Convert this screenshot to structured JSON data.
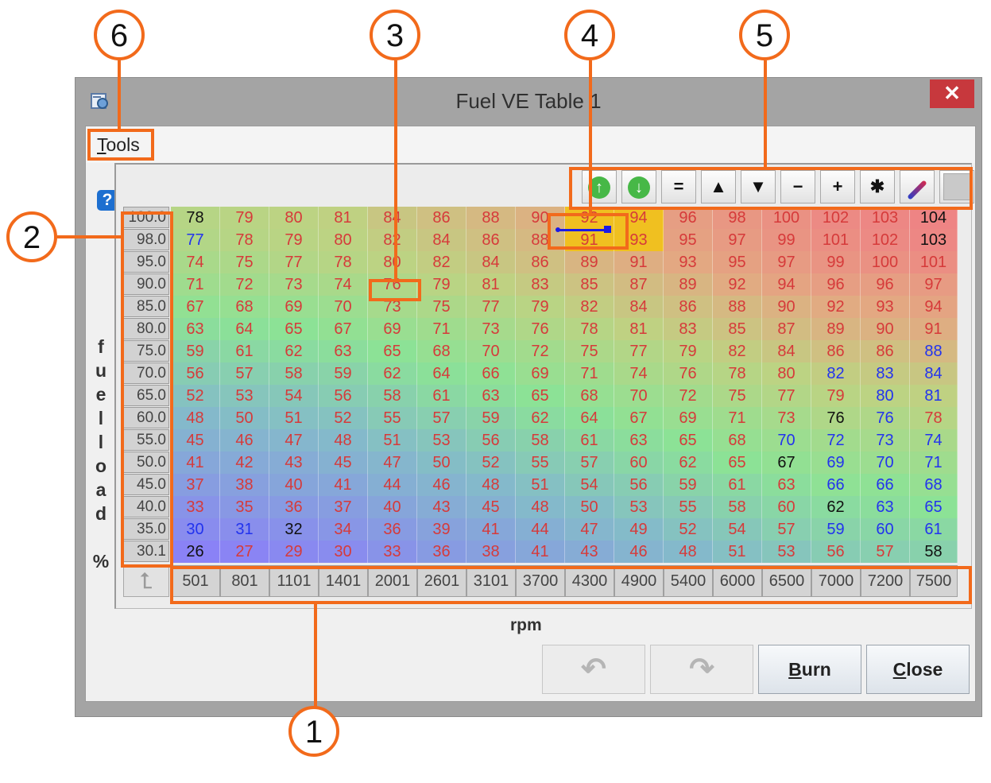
{
  "window": {
    "title": "Fuel VE Table 1",
    "close_symbol": "✕",
    "app_icon": "app-icon"
  },
  "menu": {
    "tools_underlined": "T",
    "tools_rest": "ools"
  },
  "help_icon": "?",
  "y_axis_label": [
    "f",
    "u",
    "e",
    "l",
    "l",
    "o",
    "a",
    "d",
    "",
    "%"
  ],
  "x_axis_label": "rpm",
  "toolbar": {
    "buttons": [
      {
        "name": "increment-icon",
        "symbol": "↑"
      },
      {
        "name": "decrement-icon",
        "symbol": "↓"
      },
      {
        "name": "set-equal-icon",
        "symbol": "="
      },
      {
        "name": "increase-icon",
        "symbol": "▲"
      },
      {
        "name": "decrease-icon",
        "symbol": "▼"
      },
      {
        "name": "subtract-icon",
        "symbol": "−"
      },
      {
        "name": "add-icon",
        "symbol": "+"
      },
      {
        "name": "multiply-icon",
        "symbol": "✱"
      },
      {
        "name": "interpolate-pen-icon",
        "symbol": ""
      },
      {
        "name": "blank-icon",
        "symbol": ""
      }
    ]
  },
  "table": {
    "row_headers": [
      "100.0",
      "98.0",
      "95.0",
      "90.0",
      "85.0",
      "80.0",
      "75.0",
      "70.0",
      "65.0",
      "60.0",
      "55.0",
      "50.0",
      "45.0",
      "40.0",
      "35.0",
      "30.1"
    ],
    "col_headers": [
      "501",
      "801",
      "1101",
      "1401",
      "2001",
      "2601",
      "3101",
      "3700",
      "4300",
      "4900",
      "5400",
      "6000",
      "6500",
      "7000",
      "7200",
      "7500"
    ],
    "corner_symbol": "⮤",
    "rows": [
      [
        "78",
        "79",
        "80",
        "81",
        "84",
        "86",
        "88",
        "90",
        "92",
        "94",
        "96",
        "98",
        "100",
        "102",
        "103",
        "104"
      ],
      [
        "77",
        "78",
        "79",
        "80",
        "82",
        "84",
        "86",
        "88",
        "91",
        "93",
        "95",
        "97",
        "99",
        "101",
        "102",
        "103"
      ],
      [
        "74",
        "75",
        "77",
        "78",
        "80",
        "82",
        "84",
        "86",
        "89",
        "91",
        "93",
        "95",
        "97",
        "99",
        "100",
        "101"
      ],
      [
        "71",
        "72",
        "73",
        "74",
        "76",
        "79",
        "81",
        "83",
        "85",
        "87",
        "89",
        "92",
        "94",
        "96",
        "96",
        "97"
      ],
      [
        "67",
        "68",
        "69",
        "70",
        "73",
        "75",
        "77",
        "79",
        "82",
        "84",
        "86",
        "88",
        "90",
        "92",
        "93",
        "94"
      ],
      [
        "63",
        "64",
        "65",
        "67",
        "69",
        "71",
        "73",
        "76",
        "78",
        "81",
        "83",
        "85",
        "87",
        "89",
        "90",
        "91"
      ],
      [
        "59",
        "61",
        "62",
        "63",
        "65",
        "68",
        "70",
        "72",
        "75",
        "77",
        "79",
        "82",
        "84",
        "86",
        "86",
        "88"
      ],
      [
        "56",
        "57",
        "58",
        "59",
        "62",
        "64",
        "66",
        "69",
        "71",
        "74",
        "76",
        "78",
        "80",
        "82",
        "83",
        "84"
      ],
      [
        "52",
        "53",
        "54",
        "56",
        "58",
        "61",
        "63",
        "65",
        "68",
        "70",
        "72",
        "75",
        "77",
        "79",
        "80",
        "81"
      ],
      [
        "48",
        "50",
        "51",
        "52",
        "55",
        "57",
        "59",
        "62",
        "64",
        "67",
        "69",
        "71",
        "73",
        "76",
        "76",
        "78"
      ],
      [
        "45",
        "46",
        "47",
        "48",
        "51",
        "53",
        "56",
        "58",
        "61",
        "63",
        "65",
        "68",
        "70",
        "72",
        "73",
        "74"
      ],
      [
        "41",
        "42",
        "43",
        "45",
        "47",
        "50",
        "52",
        "55",
        "57",
        "60",
        "62",
        "65",
        "67",
        "69",
        "70",
        "71"
      ],
      [
        "37",
        "38",
        "40",
        "41",
        "44",
        "46",
        "48",
        "51",
        "54",
        "56",
        "59",
        "61",
        "63",
        "66",
        "66",
        "68"
      ],
      [
        "33",
        "35",
        "36",
        "37",
        "40",
        "43",
        "45",
        "48",
        "50",
        "53",
        "55",
        "58",
        "60",
        "62",
        "63",
        "65"
      ],
      [
        "30",
        "31",
        "32",
        "34",
        "36",
        "39",
        "41",
        "44",
        "47",
        "49",
        "52",
        "54",
        "57",
        "59",
        "60",
        "61"
      ],
      [
        "26",
        "27",
        "29",
        "30",
        "33",
        "36",
        "38",
        "41",
        "43",
        "46",
        "48",
        "51",
        "53",
        "56",
        "57",
        "58"
      ]
    ],
    "colors": {
      "red_text": "#d63a3a",
      "blue_text": "#2233ee",
      "black_text": "#111111",
      "selection": "#f0c020"
    }
  },
  "buttons": {
    "undo_symbol": "↶",
    "redo_symbol": "↷",
    "burn_u": "B",
    "burn_rest": "urn",
    "close_u": "C",
    "close_rest": "lose"
  },
  "callouts": [
    "1",
    "2",
    "3",
    "4",
    "5",
    "6"
  ],
  "accent_color": "#f26a1b"
}
